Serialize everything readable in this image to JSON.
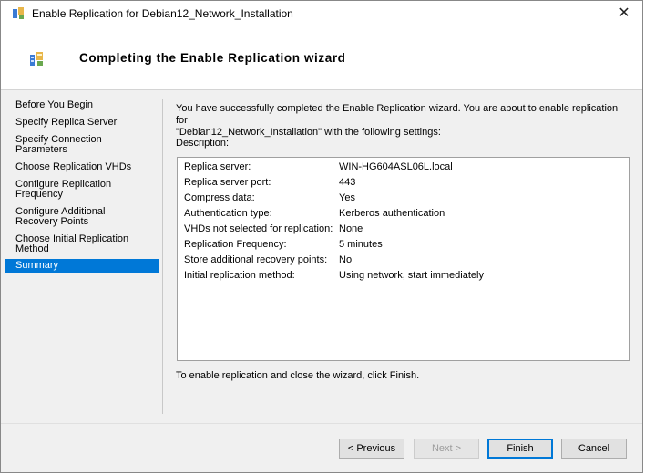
{
  "window": {
    "title": "Enable Replication for Debian12_Network_Installation",
    "close_glyph": "✕"
  },
  "header": {
    "title": "Completing the Enable Replication wizard",
    "icon": "replication-wizard-icon"
  },
  "nav": {
    "items": [
      {
        "label": "Before You Begin",
        "active": false
      },
      {
        "label": "Specify Replica Server",
        "active": false
      },
      {
        "label": "Specify Connection\nParameters",
        "active": false
      },
      {
        "label": "Choose Replication VHDs",
        "active": false
      },
      {
        "label": "Configure Replication\nFrequency",
        "active": false
      },
      {
        "label": "Configure Additional\nRecovery Points",
        "active": false
      },
      {
        "label": "Choose Initial Replication\nMethod",
        "active": false
      },
      {
        "label": "Summary",
        "active": true
      }
    ]
  },
  "content": {
    "intro_line1": "You have successfully completed the Enable Replication wizard. You are about to enable replication for",
    "intro_line2": "\"Debian12_Network_Installation\" with the following settings:",
    "description_label": "Description:",
    "settings": [
      {
        "label": "Replica server:",
        "value": "WIN-HG604ASL06L.local"
      },
      {
        "label": "Replica server port:",
        "value": "443"
      },
      {
        "label": "Compress data:",
        "value": "Yes"
      },
      {
        "label": "Authentication type:",
        "value": "Kerberos authentication"
      },
      {
        "label": "VHDs not selected for replication:",
        "value": "None"
      },
      {
        "label": "Replication Frequency:",
        "value": "5 minutes"
      },
      {
        "label": "Store additional recovery points:",
        "value": "No"
      },
      {
        "label": "Initial replication method:",
        "value": "Using network, start immediately"
      }
    ],
    "footer_text": "To enable replication and close the wizard, click Finish."
  },
  "buttons": {
    "previous": "< Previous",
    "next": "Next >",
    "finish": "Finish",
    "cancel": "Cancel"
  },
  "colors": {
    "accent": "#0078d7",
    "window_bg": "#f0f0f0"
  }
}
